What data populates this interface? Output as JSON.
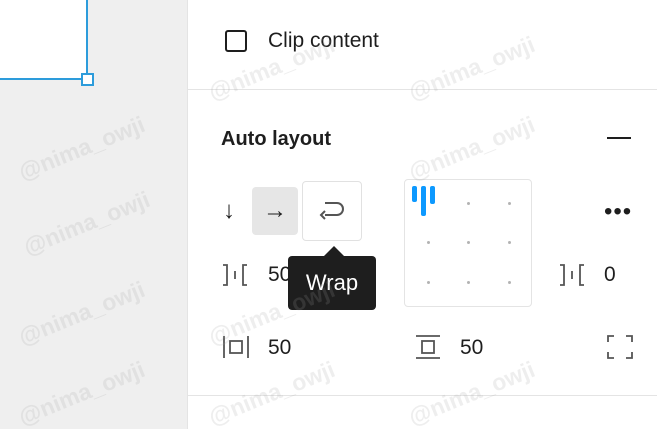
{
  "colors": {
    "accent": "#0d99ff",
    "selection": "#2d9cdb",
    "tooltip_bg": "#1e1e1e",
    "active_button_bg": "#e6e6e6",
    "canvas_bg": "#efefef"
  },
  "frame_options": {
    "clip_content_label": "Clip content",
    "clip_content_checked": false
  },
  "auto_layout": {
    "title": "Auto layout",
    "direction": {
      "vertical_glyph": "↓",
      "horizontal_glyph": "→",
      "wrap_glyph": "↩",
      "selected": "horizontal"
    },
    "item_spacing_value": "50",
    "counter_spacing_value": "0",
    "horizontal_padding_value": "50",
    "vertical_padding_value": "50",
    "more_glyph": "•••"
  },
  "tooltip": {
    "text": "Wrap"
  },
  "watermark": {
    "text": "@nima_owji"
  }
}
